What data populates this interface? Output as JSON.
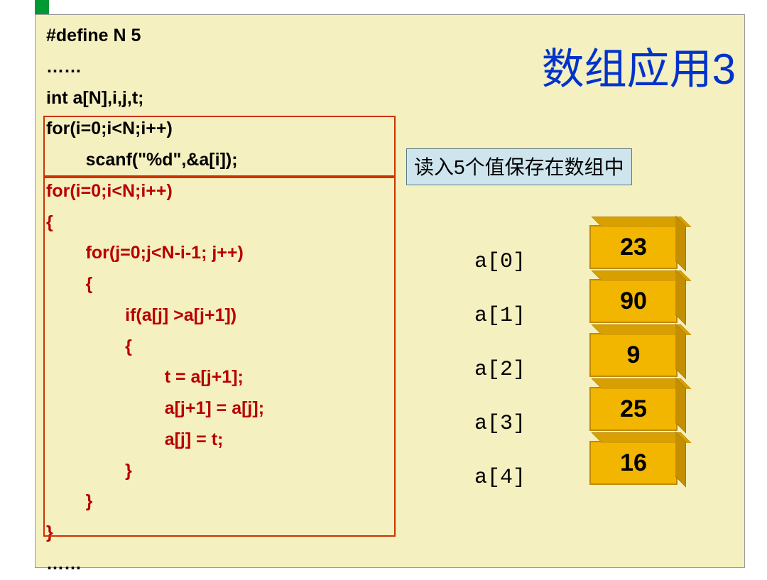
{
  "title": "数组应用3",
  "code": {
    "l1": "#define N 5",
    "l2": "……",
    "l3": "int a[N],i,j,t;",
    "l4": "for(i=0;i<N;i++)",
    "l5": "        scanf(\"%d\",&a[i]);",
    "l6": "for(i=0;i<N;i++)",
    "l7": "{",
    "l8": "        for(j=0;j<N-i-1; j++)",
    "l9": "        {",
    "l10": "                if(a[j] >a[j+1])",
    "l11": "                {",
    "l12": "                        t = a[j+1];",
    "l13": "                        a[j+1] = a[j];",
    "l14": "                        a[j] = t;",
    "l15": "                }",
    "l16": "        }",
    "l17": "}",
    "l18": "……"
  },
  "annotation": "读入5个值保存在数组中",
  "array": {
    "labels": [
      "a[0]",
      "a[1]",
      "a[2]",
      "a[3]",
      "a[4]"
    ],
    "values": [
      "23",
      "90",
      "9",
      "25",
      "16"
    ]
  }
}
